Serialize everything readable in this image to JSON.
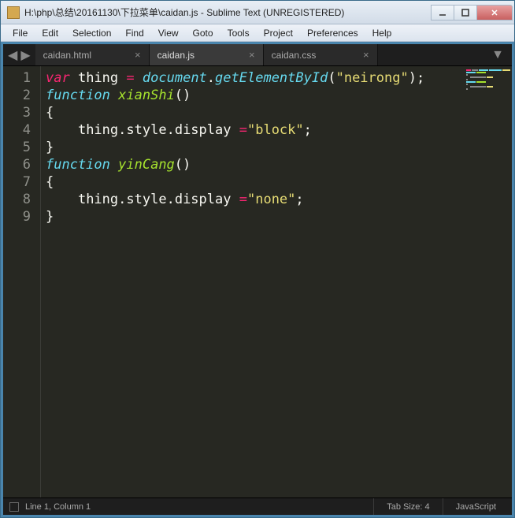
{
  "window": {
    "title": "H:\\php\\总结\\20161130\\下拉菜单\\caidan.js - Sublime Text (UNREGISTERED)"
  },
  "menubar": [
    "File",
    "Edit",
    "Selection",
    "Find",
    "View",
    "Goto",
    "Tools",
    "Project",
    "Preferences",
    "Help"
  ],
  "tabs": [
    {
      "label": "caidan.html",
      "active": false
    },
    {
      "label": "caidan.js",
      "active": true
    },
    {
      "label": "caidan.css",
      "active": false
    }
  ],
  "gutter": [
    "1",
    "2",
    "3",
    "4",
    "5",
    "6",
    "7",
    "8",
    "9"
  ],
  "code": {
    "l1": {
      "var": "var",
      "name": "thing",
      "eq": "=",
      "doc": "document",
      "dot": ".",
      "fn": "getElementById",
      "lp": "(",
      "arg": "\"neirong\"",
      "rp": ")",
      "semi": ";"
    },
    "l2": {
      "kw": "function",
      "fn": "xianShi",
      "lp": "(",
      "rp": ")"
    },
    "l3": {
      "brace": "{"
    },
    "l4": {
      "indent": "    ",
      "obj": "thing",
      "d1": ".",
      "p1": "style",
      "d2": ".",
      "p2": "display",
      "sp": " ",
      "eq": "=",
      "str": "\"block\"",
      "semi": ";"
    },
    "l5": {
      "brace": "}"
    },
    "l6": {
      "kw": "function",
      "fn": "yinCang",
      "lp": "(",
      "rp": ")"
    },
    "l7": {
      "brace": "{"
    },
    "l8": {
      "indent": "    ",
      "obj": "thing",
      "d1": ".",
      "p1": "style",
      "d2": ".",
      "p2": "display",
      "sp": " ",
      "eq": "=",
      "str": "\"none\"",
      "semi": ";"
    },
    "l9": {
      "brace": "}"
    }
  },
  "status": {
    "position": "Line 1, Column 1",
    "tabsize": "Tab Size: 4",
    "syntax": "JavaScript"
  }
}
